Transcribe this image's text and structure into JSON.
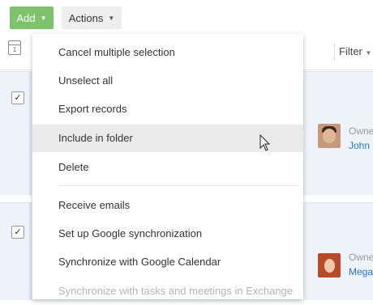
{
  "toolbar": {
    "add_label": "Add",
    "actions_label": "Actions"
  },
  "list_toolbar": {
    "calendar_icon": "calendar-icon",
    "calendar_day": "1",
    "filter_label": "Filter"
  },
  "rows": [
    {
      "checked": "✓",
      "owner_label": "Owne",
      "owner_name": "John"
    },
    {
      "checked": "✓",
      "owner_label": "Owne",
      "owner_name": "Mega"
    }
  ],
  "menu": {
    "items": [
      {
        "label": "Cancel multiple selection"
      },
      {
        "label": "Unselect all"
      },
      {
        "label": "Export records"
      },
      {
        "label": "Include in folder"
      },
      {
        "label": "Delete"
      },
      {
        "label": "Receive emails"
      },
      {
        "label": "Set up Google synchronization"
      },
      {
        "label": "Synchronize with Google Calendar"
      },
      {
        "label": "Synchronize with tasks and meetings in Exchange"
      }
    ]
  },
  "colors": {
    "add_button": "#7ec26a",
    "row_background": "#eef3fa",
    "link": "#2a73c9",
    "menu_hover": "#ebebeb"
  }
}
